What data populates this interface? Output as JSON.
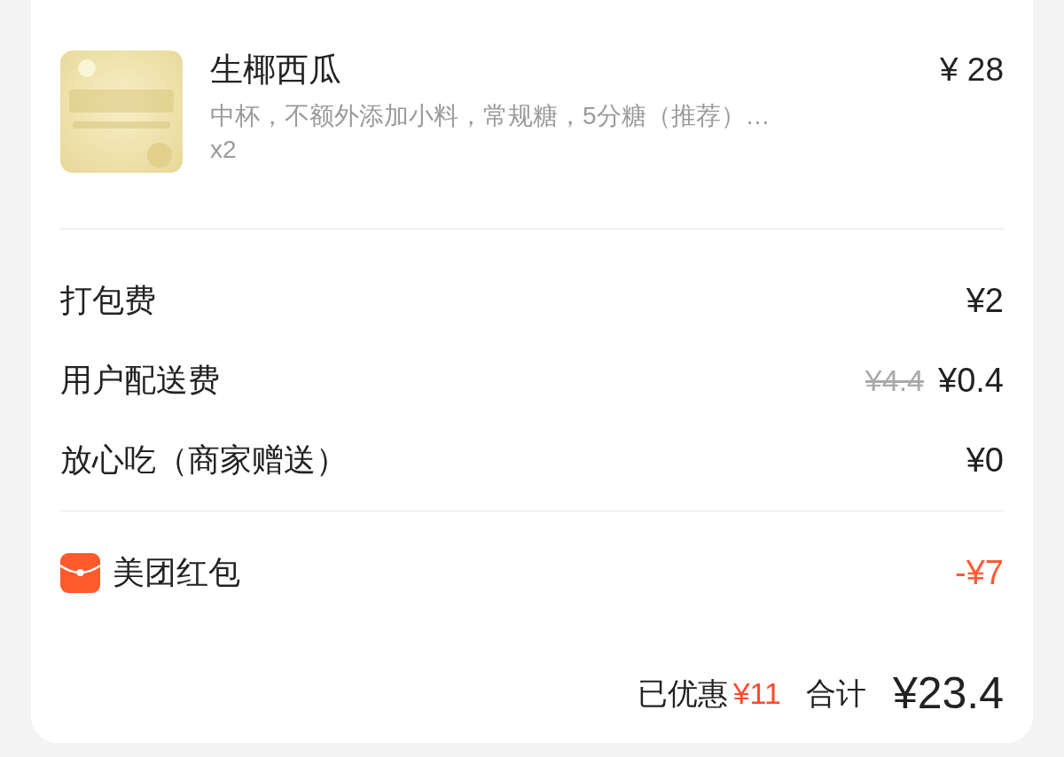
{
  "item": {
    "name": "生椰西瓜",
    "specs": "中杯，不额外添加小料，常规糖，5分糖（推荐）…",
    "quantity": "x2",
    "price": "¥ 28"
  },
  "fees": [
    {
      "label": "打包费",
      "price": "¥2"
    },
    {
      "label": "用户配送费",
      "original_price": "¥4.4",
      "price": "¥0.4"
    },
    {
      "label": "放心吃（商家赠送）",
      "price": "¥0"
    }
  ],
  "red_packet": {
    "label": "美团红包",
    "amount": "-¥7"
  },
  "summary": {
    "discount_label": "已优惠",
    "discount": "¥11",
    "total_label": "合计",
    "total": "¥23.4"
  }
}
